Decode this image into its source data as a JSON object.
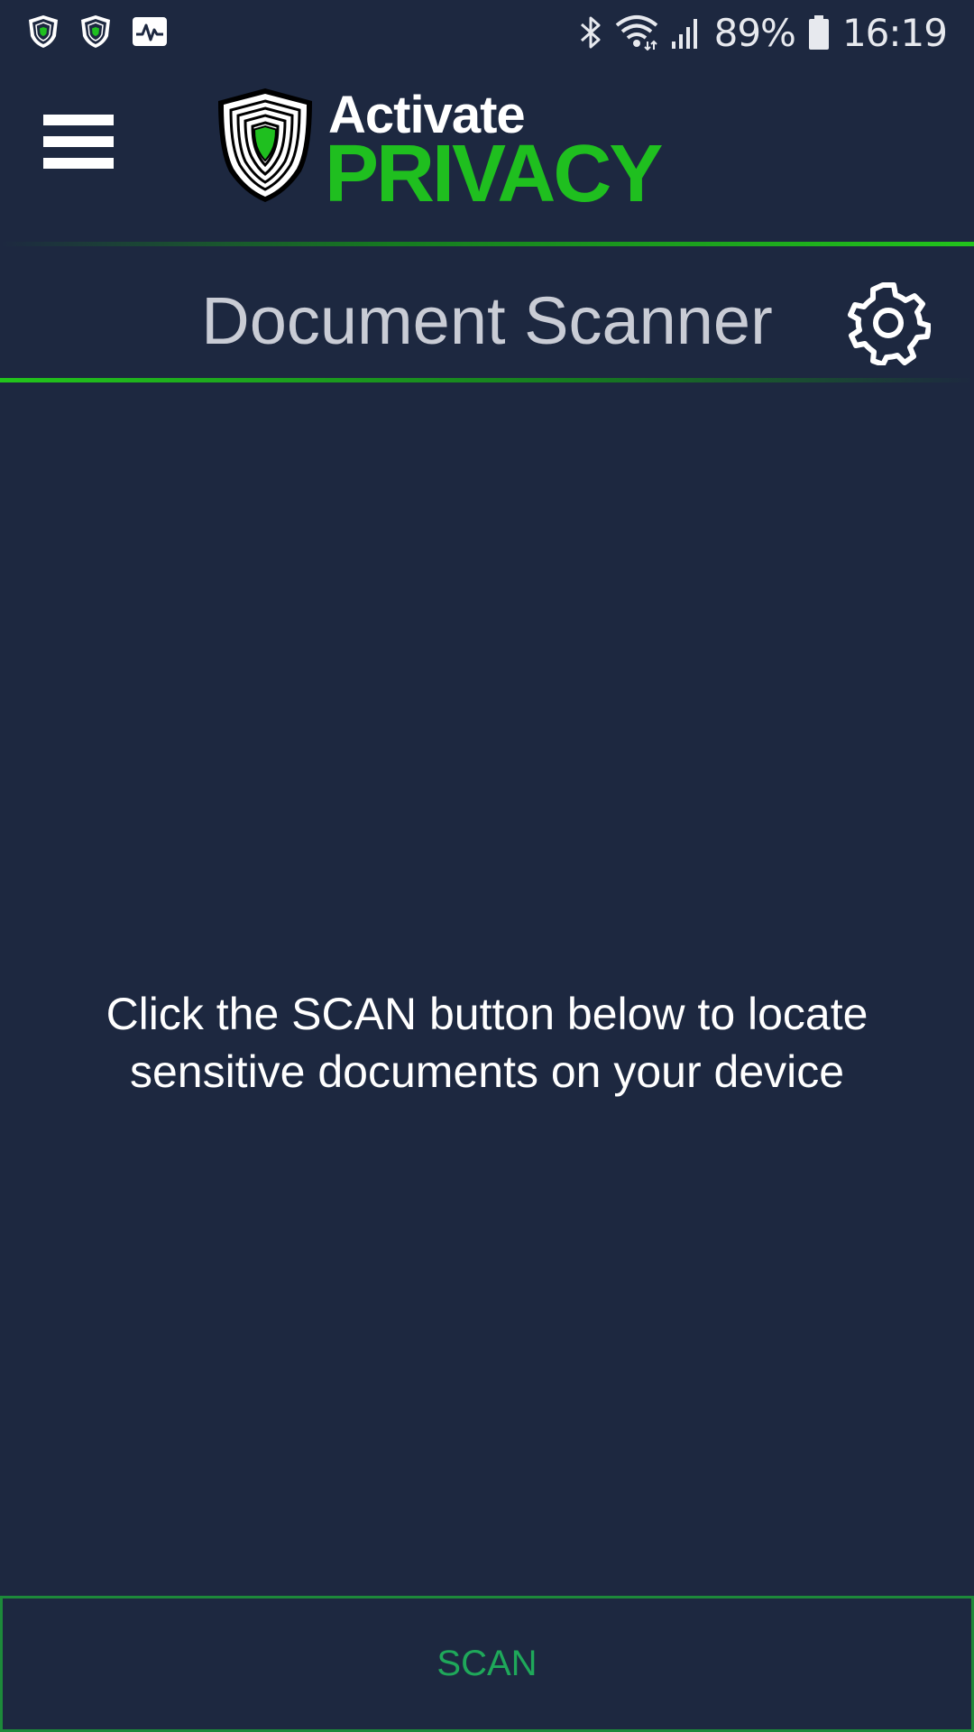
{
  "status_bar": {
    "notification_icons": [
      "shield-app-icon",
      "shield-app-icon",
      "activity-monitor-icon"
    ],
    "system_icons": [
      "bluetooth-icon",
      "wifi-icon",
      "signal-icon",
      "battery-icon"
    ],
    "battery": "89%",
    "time": "16:19"
  },
  "header": {
    "menu_icon": "hamburger-menu-icon",
    "logo": {
      "word1": "Activate",
      "word2": "PRIVACY",
      "shield_icon": "fingerprint-shield-icon"
    }
  },
  "page": {
    "title": "Document Scanner",
    "settings_icon": "gear-icon",
    "instruction_line1": "Click the SCAN button below to locate",
    "instruction_line2": "sensitive documents on your device"
  },
  "actions": {
    "scan_label": "SCAN"
  },
  "colors": {
    "background": "#1d2840",
    "brand_green": "#1fbf1f",
    "scan_text": "#1fa85a",
    "scan_border": "#1d8a3a",
    "title_text": "#c9ccd5"
  }
}
